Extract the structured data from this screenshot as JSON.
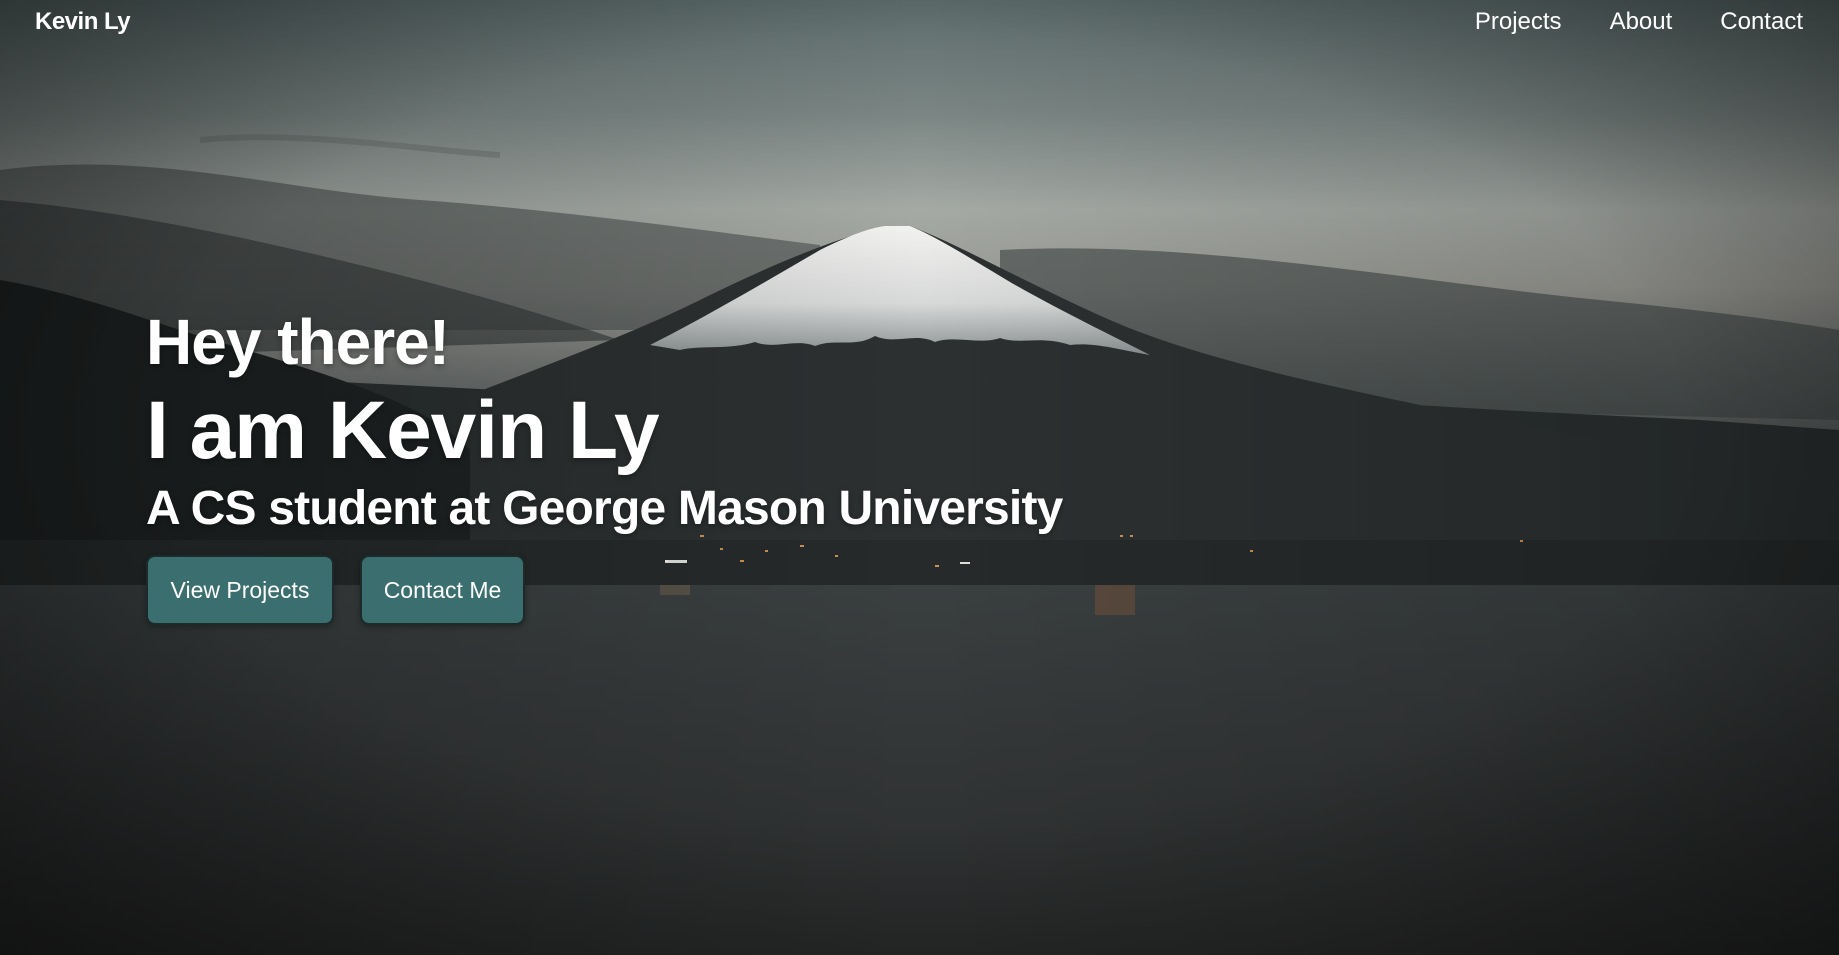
{
  "navbar": {
    "brand": "Kevin Ly",
    "links": [
      {
        "label": "Projects"
      },
      {
        "label": "About"
      },
      {
        "label": "Contact"
      }
    ]
  },
  "hero": {
    "greeting": "Hey there!",
    "name": "I am Kevin Ly",
    "subtitle": "A CS student at George Mason University",
    "buttons": {
      "view_projects": "View Projects",
      "contact_me": "Contact Me"
    },
    "background": "mountain-lake-photo"
  },
  "colors": {
    "button_bg": "#3b6e6f",
    "text": "#ffffff",
    "sky_top": "#5f6e6e",
    "water": "#2e3131"
  }
}
